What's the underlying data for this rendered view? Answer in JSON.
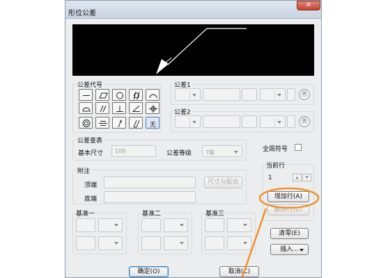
{
  "window": {
    "title": "形位公差",
    "close_glyph": "✕"
  },
  "tolerance_code": {
    "label": "公差代号",
    "symbols": [
      "straightness-icon",
      "flatness-icon",
      "circularity-icon",
      "cylindricity-icon",
      "line-profile-icon",
      "surface-profile-icon",
      "parallelism-icon",
      "perpendicularity-icon",
      "angularity-icon",
      "position-icon",
      "concentricity-icon",
      "symmetry-icon",
      "circular-runout-icon",
      "total-runout-icon",
      "none-icon"
    ],
    "none_label": "无"
  },
  "tolerance1": {
    "label": "公差1",
    "modifier": "Ⓡ"
  },
  "tolerance2": {
    "label": "公差2",
    "modifier": "Ⓡ"
  },
  "lookup": {
    "label": "公差查表",
    "basic_size_label": "基本尺寸",
    "basic_size_value": "100",
    "grade_label": "公差等级",
    "grade_value": "7级"
  },
  "all_around": {
    "label": "全周符号"
  },
  "current_row": {
    "label": "当前行",
    "value": "1",
    "up": "▲",
    "down": "▼"
  },
  "note": {
    "label": "附注",
    "top_label": "顶端",
    "bottom_label": "底端",
    "size_button": "尺寸与配合"
  },
  "datums": [
    {
      "label": "基准一"
    },
    {
      "label": "基准二"
    },
    {
      "label": "基准三"
    }
  ],
  "buttons": {
    "add_row": "增加行(A)",
    "delete_row": "删除行(D)",
    "clear": "清零(E)",
    "insert": "插入...",
    "ok": "确定(O)",
    "cancel": "取消(C)"
  },
  "colors": {
    "annotation": "#f0912a",
    "preview_bg": "#000000",
    "preview_line": "#ffffff"
  }
}
